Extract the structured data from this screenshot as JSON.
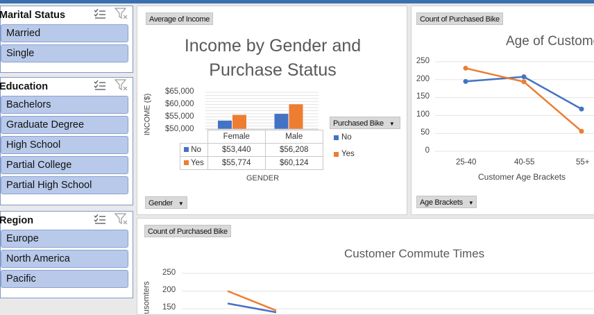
{
  "slicers": [
    {
      "title": "Marital Status",
      "items": [
        "Married",
        "Single"
      ]
    },
    {
      "title": "Education",
      "items": [
        "Bachelors",
        "Graduate Degree",
        "High School",
        "Partial College",
        "Partial High School"
      ]
    },
    {
      "title": "Region",
      "items": [
        "Europe",
        "North America",
        "Pacific"
      ]
    }
  ],
  "icons": {
    "multiselect": "multi-select-icon",
    "clearfilter": "clear-filter-icon",
    "dropdown": "dropdown-arrow-icon"
  },
  "colors": {
    "no": "#4472c4",
    "yes": "#ed7d31",
    "slicer_item": "#b8c9ea",
    "topbar": "#3a6fb0"
  },
  "income_chart": {
    "field_button": "Average of Income",
    "title_line1": "Income by Gender and",
    "title_line2": "Purchase Status",
    "ylabel": "INCOME ($)",
    "y_ticks": [
      "$65,000",
      "$60,000",
      "$55,000",
      "$50,000"
    ],
    "xlabel": "GENDER",
    "legend_button": "Purchased Bike",
    "axis_button": "Gender",
    "table_headers": [
      "Female",
      "Male"
    ],
    "rows": [
      {
        "label": "No",
        "values": [
          "$53,440",
          "$56,208"
        ]
      },
      {
        "label": "Yes",
        "values": [
          "$55,774",
          "$60,124"
        ]
      }
    ]
  },
  "age_chart": {
    "field_button": "Count of Purchased Bike",
    "title": "Age of Custome",
    "y_ticks": [
      "250",
      "200",
      "150",
      "100",
      "50",
      "0"
    ],
    "x_ticks": [
      "25-40",
      "40-55",
      "55+"
    ],
    "xlabel": "Customer Age Brackets",
    "axis_button": "Age Brackets"
  },
  "commute_chart": {
    "field_button": "Count of Purchased Bike",
    "title": "Customer Commute Times",
    "y_ticks": [
      "250",
      "200",
      "150"
    ],
    "ylabel": "usomters"
  },
  "chart_data": [
    {
      "type": "bar",
      "title": "Income by Gender and Purchase Status",
      "xlabel": "GENDER",
      "ylabel": "INCOME ($)",
      "categories": [
        "Female",
        "Male"
      ],
      "ylim": [
        50000,
        65000
      ],
      "series": [
        {
          "name": "No",
          "values": [
            53440,
            56208
          ]
        },
        {
          "name": "Yes",
          "values": [
            55774,
            60124
          ]
        }
      ],
      "legend": "right",
      "grid": true
    },
    {
      "type": "line",
      "title": "Age of Custome",
      "xlabel": "Customer Age Brackets",
      "categories": [
        "25-40",
        "40-55",
        "55+"
      ],
      "ylim": [
        0,
        250
      ],
      "series": [
        {
          "name": "No",
          "values": [
            195,
            208,
            118
          ]
        },
        {
          "name": "Yes",
          "values": [
            232,
            194,
            56
          ]
        }
      ],
      "grid": true
    },
    {
      "type": "line",
      "title": "Customer Commute Times",
      "ylabel": "usomters",
      "ylim": [
        150,
        250
      ],
      "series": [
        {
          "name": "No",
          "values": [
            165,
            140
          ]
        },
        {
          "name": "Yes",
          "values": [
            200,
            145
          ]
        }
      ],
      "grid": true
    }
  ]
}
